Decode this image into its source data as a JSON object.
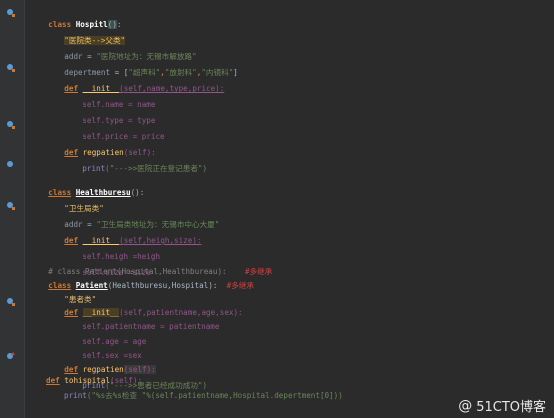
{
  "editor": {
    "lines": {
      "l1": {
        "kw": "class",
        "name": "Hospitl",
        "brace": "()",
        "colon": ":"
      },
      "l2": {
        "text": "\"医院类-->父类\""
      },
      "l3": {
        "var": "addr",
        "eq": " = ",
        "val": "\"医院地址为：无锡市解放路\""
      },
      "l4": {
        "var": "depertment",
        "eq": " = [",
        "v1": "\"超声科\"",
        "sep": ",",
        "v2": "\"放射科\"",
        "v3": "\"内镜科\"",
        "end": "]"
      },
      "l5": {
        "kw": "def",
        "name": "__init__",
        "args": "(self,name,type,price):"
      },
      "l6": {
        "text": "self.name = name"
      },
      "l7": {
        "text": "self.type = type"
      },
      "l8": {
        "text": "self.price = price"
      },
      "l9": {
        "kw": "def",
        "name": "regpatien",
        "args": "(self):"
      },
      "l10": {
        "fn": "print",
        "arg": "(\"--->>医院正在登记患者\")"
      },
      "l11": {
        "kw": "class",
        "name": "Healthburesu",
        "brace": "()",
        "colon": ":"
      },
      "l12": {
        "text": "\"卫生局类\""
      },
      "l13": {
        "var": "addr",
        "eq": " = ",
        "val": "\"卫生局类地址为：无锡市中心大厦\""
      },
      "l14": {
        "kw": "def",
        "name": "__init__",
        "args": "(self,heigh,size):"
      },
      "l15": {
        "text": "self.heigh =heigh"
      },
      "l16": {
        "text": "self.size =size"
      },
      "l17": {
        "comment": "# class Patient(Hospital,Healthbureau):",
        "note": "#多继承"
      },
      "l18": {
        "kw": "class",
        "name": "Patient",
        "args": "(Healthburesu,Hospital):",
        "note": "#多继承"
      },
      "l19": {
        "text": "\"患者类\""
      },
      "l20": {
        "kw": "def",
        "name": "__init__",
        "args": "(self,patientname,age,sex):"
      },
      "l21": {
        "text": "self.patientname = patientname"
      },
      "l22": {
        "text": "self.age = age"
      },
      "l23": {
        "text": "self.sex =sex"
      },
      "l24": {
        "kw": "def",
        "name": "regpatien",
        "args": "(self):"
      },
      "l25": {
        "fn": "print",
        "arg": "(\"--->>患者已经成功成功\")"
      },
      "l26": {
        "kw": "def",
        "name": "tohispital",
        "args": "(self):"
      },
      "l27": {
        "fn": "print",
        "arg": "(\"%s去%s检查 \"%(self.patientname,Hospital.depertment[0]))"
      }
    }
  },
  "watermark": {
    "at": "@",
    "text": "51CTO博客"
  }
}
